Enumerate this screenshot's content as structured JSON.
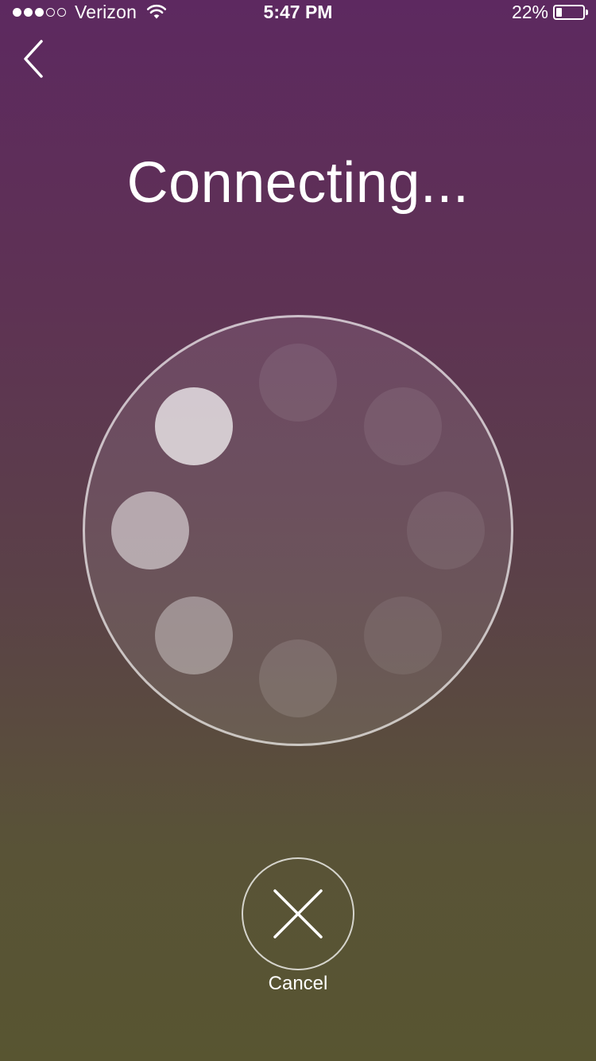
{
  "status_bar": {
    "signal_strength": "3/5",
    "carrier": "Verizon",
    "wifi_icon": "wifi-icon",
    "time": "5:47 PM",
    "battery_percent": "22%",
    "battery_level": 0.22,
    "battery_icon": "battery-icon"
  },
  "nav": {
    "back_icon": "chevron-left-icon"
  },
  "title": "Connecting...",
  "spinner": {
    "dot_count": 8,
    "dot_opacities": [
      0.08,
      0.08,
      0.08,
      0.08,
      0.12,
      0.35,
      0.5,
      0.7
    ]
  },
  "cancel": {
    "icon": "close-icon",
    "label": "Cancel"
  },
  "colors": {
    "gradient_top": "#5d2960",
    "gradient_bottom": "#585531",
    "foreground": "#ffffff"
  }
}
